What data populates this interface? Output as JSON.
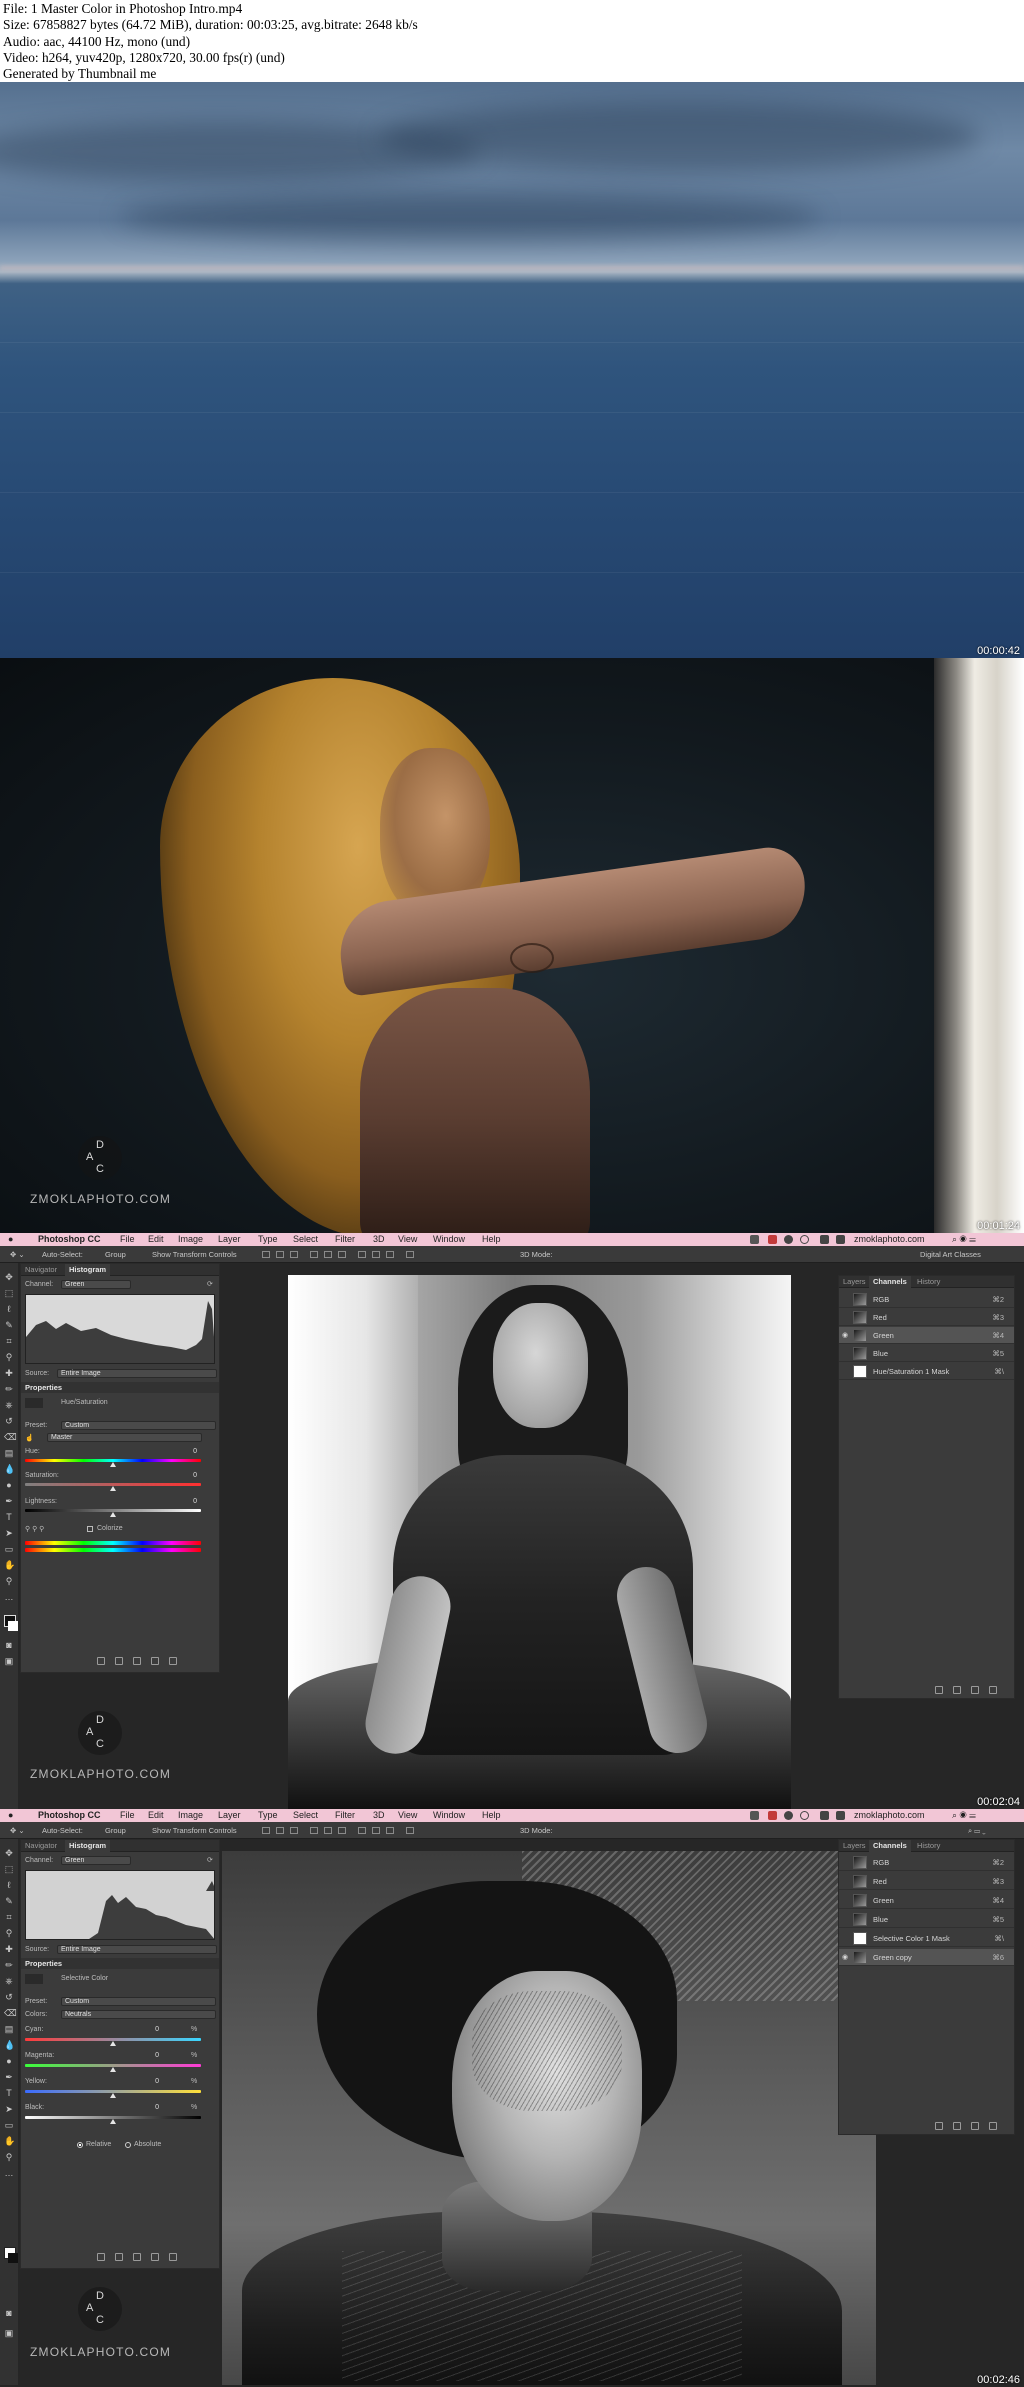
{
  "header": {
    "lines": [
      "File: 1 Master Color in Photoshop Intro.mp4",
      "Size: 67858827 bytes (64.72 MiB), duration: 00:03:25, avg.bitrate: 2648 kb/s",
      "Audio: aac, 44100 Hz, mono (und)",
      "Video: h264, yuv420p, 1280x720, 30.00 fps(r) (und)",
      "Generated by Thumbnail me"
    ]
  },
  "frames": [
    {
      "timestamp": "00:00:42"
    },
    {
      "timestamp": "00:01:24",
      "watermark": "ZMOKLAPHOTO.COM"
    },
    {
      "timestamp": "00:02:04",
      "watermark": "ZMOKLAPHOTO.COM"
    },
    {
      "timestamp": "00:02:46",
      "watermark": "ZMOKLAPHOTO.COM"
    }
  ],
  "logo_letters": {
    "top": "D",
    "left": "A",
    "bottom": "C"
  },
  "photoshop": {
    "app_name": "Photoshop CC",
    "menu": [
      "File",
      "Edit",
      "Image",
      "Layer",
      "Type",
      "Select",
      "Filter",
      "3D",
      "View",
      "Window",
      "Help"
    ],
    "site": "zmoklaphoto.com",
    "options": {
      "auto_select": "Auto-Select:",
      "group": "Group",
      "transform": "Show Transform Controls",
      "mode": "3D Mode:",
      "workspace": "Digital Art Classes"
    },
    "left_tabs": [
      "Navigator",
      "Histogram"
    ],
    "channel_label": "Channel:",
    "channel_value": "Green",
    "source_label": "Source:",
    "source_value": "Entire Image",
    "properties_title": "Properties",
    "preset_label": "Preset:",
    "preset_value": "Custom",
    "right_tabs": [
      "Layers",
      "Channels",
      "History"
    ]
  },
  "frame3_panel": {
    "adjustment": "Hue/Saturation",
    "range": "Master",
    "sliders": [
      {
        "label": "Hue:",
        "value": "0"
      },
      {
        "label": "Saturation:",
        "value": "0"
      },
      {
        "label": "Lightness:",
        "value": "0"
      }
    ],
    "colorize": "Colorize",
    "channels": [
      {
        "name": "RGB",
        "key": "⌘2"
      },
      {
        "name": "Red",
        "key": "⌘3"
      },
      {
        "name": "Green",
        "key": "⌘4"
      },
      {
        "name": "Blue",
        "key": "⌘5"
      },
      {
        "name": "Hue/Saturation 1 Mask",
        "key": "⌘\\"
      }
    ]
  },
  "frame4_panel": {
    "adjustment": "Selective Color",
    "colors_label": "Colors:",
    "colors_value": "Neutrals",
    "sliders": [
      {
        "label": "Cyan:",
        "value": "0",
        "unit": "%"
      },
      {
        "label": "Magenta:",
        "value": "0",
        "unit": "%"
      },
      {
        "label": "Yellow:",
        "value": "0",
        "unit": "%"
      },
      {
        "label": "Black:",
        "value": "0",
        "unit": "%"
      }
    ],
    "relative": "Relative",
    "absolute": "Absolute",
    "channels": [
      {
        "name": "RGB",
        "key": "⌘2"
      },
      {
        "name": "Red",
        "key": "⌘3"
      },
      {
        "name": "Green",
        "key": "⌘4"
      },
      {
        "name": "Blue",
        "key": "⌘5"
      },
      {
        "name": "Selective Color 1 Mask",
        "key": "⌘\\"
      },
      {
        "name": "Green copy",
        "key": "⌘6"
      }
    ]
  },
  "colors": {
    "menubar": "#f2c6d6",
    "panel": "#3b3b3b",
    "canvas_bg": "#262626"
  }
}
